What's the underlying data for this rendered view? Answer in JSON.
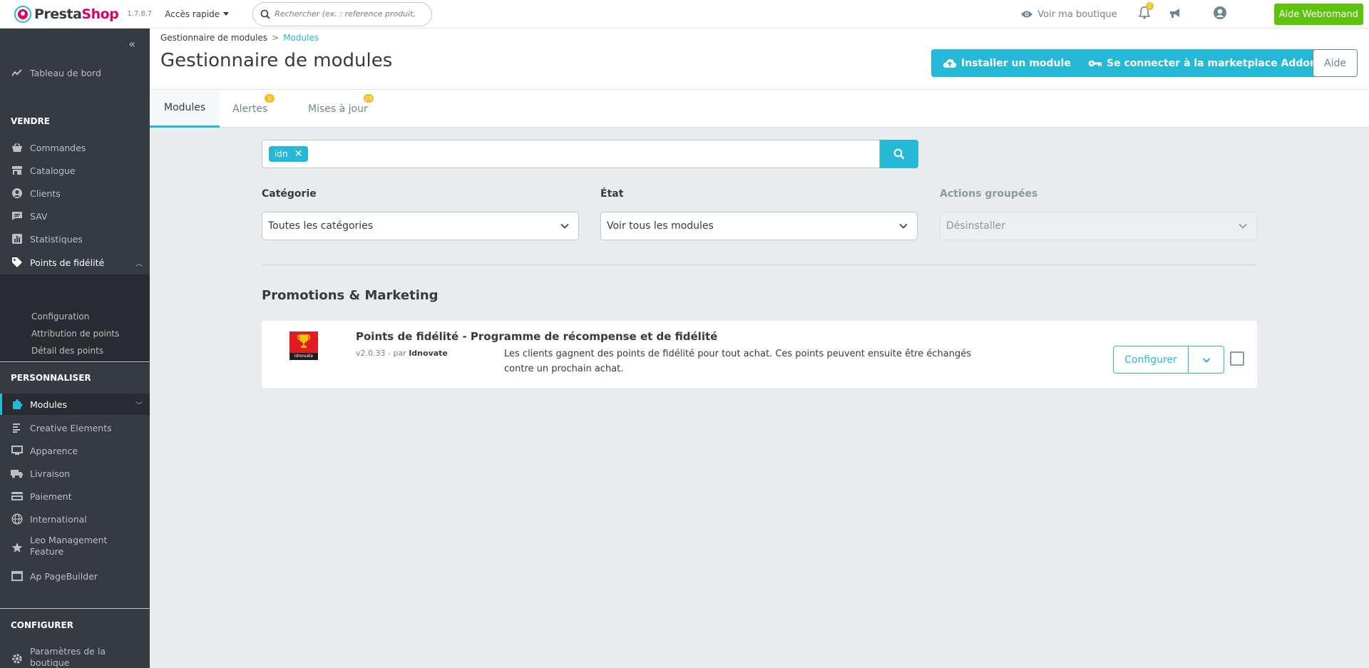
{
  "header": {
    "logo_part1": "Presta",
    "logo_part2": "Shop",
    "version": "1.7.8.7",
    "quick_access": "Accès rapide",
    "search_placeholder": "Rechercher (ex. : reference produit, no",
    "view_shop": "Voir ma boutique",
    "notif_count": "3",
    "help_button": "Aide Webromand"
  },
  "sidebar": {
    "dashboard": "Tableau de bord",
    "section_sell": "VENDRE",
    "sell_items": [
      "Commandes",
      "Catalogue",
      "Clients",
      "SAV",
      "Statistiques",
      "Points de fidélité"
    ],
    "loyalty_sub": [
      "Configuration",
      "Attribution de points",
      "Détail des points"
    ],
    "section_customize": "PERSONNALISER",
    "customize_items": [
      "Modules",
      "Creative Elements",
      "Apparence",
      "Livraison",
      "Paiement",
      "International",
      "Leo Management",
      "Feature",
      "Ap PageBuilder"
    ],
    "section_configure": "CONFIGURER",
    "configure_items": [
      "Paramètres de la",
      "boutique"
    ]
  },
  "page": {
    "breadcrumb_parent": "Gestionnaire de modules",
    "breadcrumb_sep": ">",
    "breadcrumb_current": "Modules",
    "title": "Gestionnaire de modules",
    "btn_install": "Installer un module",
    "btn_connect": "Se connecter à la marketplace Addons",
    "btn_help": "Aide"
  },
  "tabs": [
    {
      "label": "Modules",
      "badge": ""
    },
    {
      "label": "Alertes",
      "badge": "0"
    },
    {
      "label": "Mises à jour",
      "badge": "29"
    }
  ],
  "filters": {
    "search_tag": "idn",
    "category_label": "Catégorie",
    "category_value": "Toutes les catégories",
    "state_label": "État",
    "state_value": "Voir tous les modules",
    "bulk_label": "Actions groupées",
    "bulk_value": "Désinstaller"
  },
  "section": {
    "title": "Promotions & Marketing"
  },
  "module": {
    "logo_text": "idnovate",
    "name": "Points de fidélité - Programme de récompense et de fidélité",
    "version": "v2.0.33 - par",
    "author": "Idnovate",
    "description": "Les clients gagnent des points de fidélité pour tout achat. Ces points peuvent ensuite être échangés contre un prochain achat.",
    "configure": "Configurer"
  },
  "colors": {
    "primary": "#25b9d7",
    "sidebar": "#363a41",
    "help_green": "#5fc20e",
    "badge": "#fbbb22"
  }
}
